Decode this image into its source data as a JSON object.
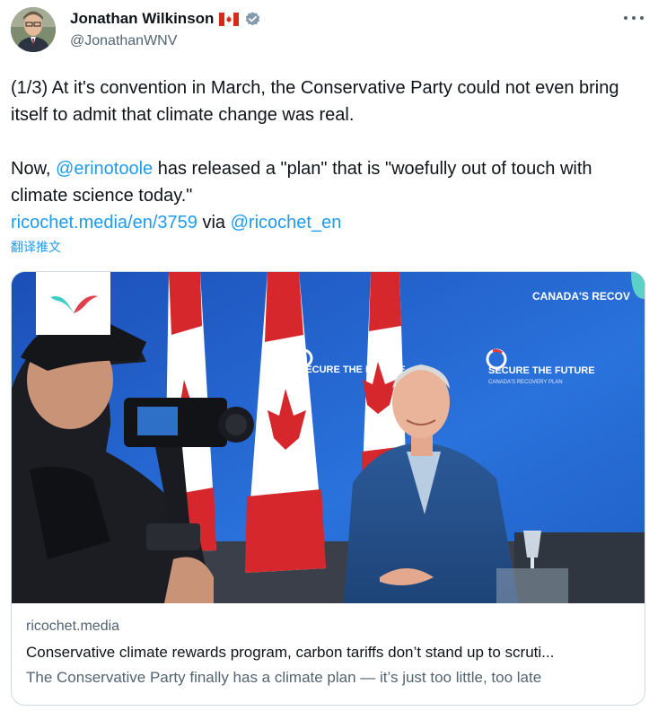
{
  "author": {
    "display_name": "Jonathan Wilkinson",
    "handle": "@JonathanWNV",
    "flag_icon": "canada-flag-emoji",
    "verified_icon": "verified-badge-icon"
  },
  "more_icon": "more-options-icon",
  "tweet": {
    "p1": "(1/3) At it's convention in March, the Conservative Party could not even bring itself to admit that climate change was real.",
    "p2_prefix": "Now, ",
    "mention1": "@erinotoole",
    "p2_suffix": " has released a \"plan\" that is \"woefully out of touch with climate science today.\"",
    "link": "ricochet.media/en/3759",
    "via": " via ",
    "mention2": "@ricochet_en",
    "translate": "翻译推文"
  },
  "card": {
    "image_signs": {
      "secure_future_left": "SECURE THE FUTURE",
      "secure_future_right": "SECURE THE FUTURE",
      "recovery_plan_top": "CANADA'S RECOV",
      "recovery_plan_small": "CANADA'S RECOVERY PLAN"
    },
    "domain": "ricochet.media",
    "title": "Conservative climate rewards program, carbon tariffs don’t stand up to scruti...",
    "description": "The Conservative Party finally has a climate plan — it’s just too little, too late"
  },
  "colors": {
    "link_blue": "#1d9bf0",
    "text_primary": "#0f1419",
    "text_secondary": "#536471",
    "border": "#cfd9de"
  }
}
